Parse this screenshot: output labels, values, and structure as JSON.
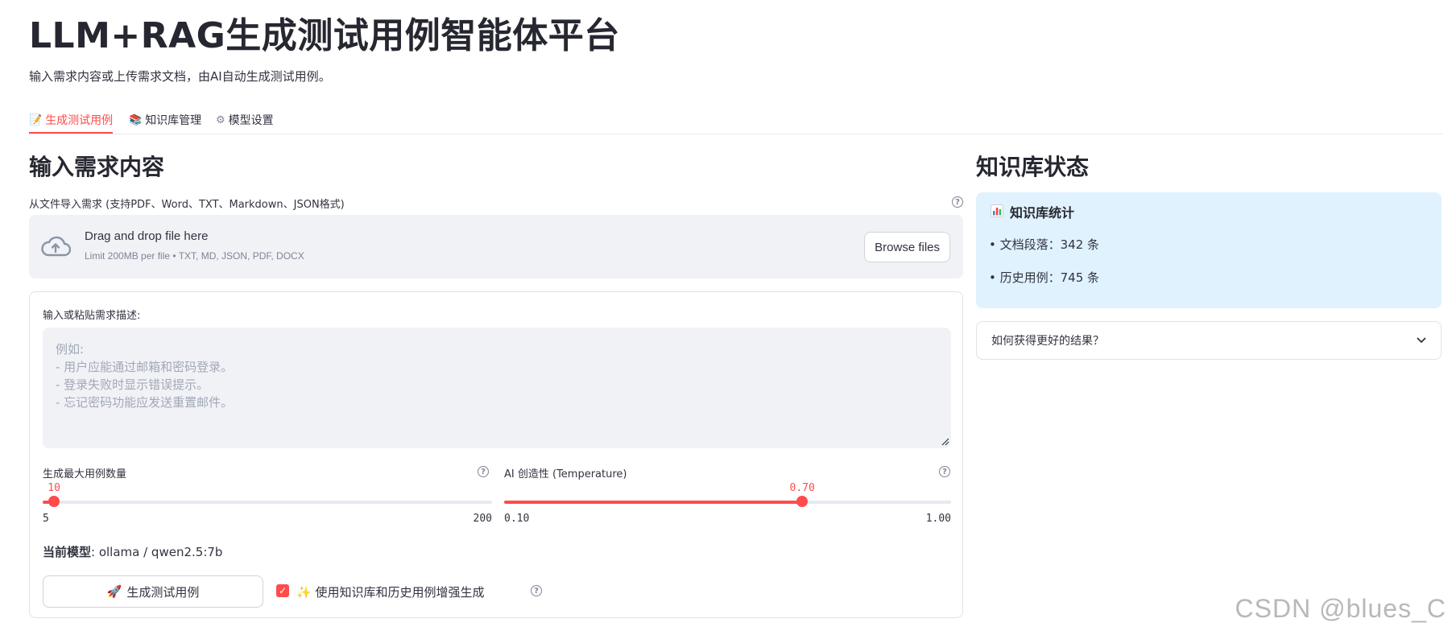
{
  "app": {
    "title": "LLM+RAG生成测试用例智能体平台",
    "subtitle": "输入需求内容或上传需求文档，由AI自动生成测试用例。"
  },
  "tabs": [
    {
      "label": "生成测试用例",
      "icon": "memo-icon",
      "active": true
    },
    {
      "label": "知识库管理",
      "icon": "books-icon",
      "active": false
    },
    {
      "label": "模型设置",
      "icon": "gear-icon",
      "active": false
    }
  ],
  "main": {
    "heading": "输入需求内容",
    "upload": {
      "label": "从文件导入需求 (支持PDF、Word、TXT、Markdown、JSON格式)",
      "drop_text": "Drag and drop file here",
      "limit_text": "Limit 200MB per file • TXT, MD, JSON, PDF, DOCX",
      "browse_label": "Browse files"
    },
    "requirement": {
      "label": "输入或粘贴需求描述:",
      "placeholder": "例如:\n- 用户应能通过邮箱和密码登录。\n- 登录失败时显示错误提示。\n- 忘记密码功能应发送重置邮件。",
      "value": ""
    },
    "max_cases": {
      "label": "生成最大用例数量",
      "value": 10,
      "value_text": "10",
      "min": 5,
      "max": 200,
      "min_text": "5",
      "max_text": "200"
    },
    "temperature": {
      "label": "AI 创造性 (Temperature)",
      "value": 0.7,
      "value_text": "0.70",
      "min": 0.1,
      "max": 1.0,
      "min_text": "0.10",
      "max_text": "1.00"
    },
    "model": {
      "label": "当前模型",
      "value": ": ollama / qwen2.5:7b"
    },
    "generate_button": "生成测试用例",
    "rag_checkbox": {
      "label": "✨ 使用知识库和历史用例增强生成",
      "checked": true
    }
  },
  "side": {
    "heading": "知识库状态",
    "stats_title": "知识库统计",
    "stats": [
      "• 文档段落：342 条",
      "• 历史用例：745 条"
    ],
    "expander_label": "如何获得更好的结果？"
  },
  "watermark": "CSDN @blues_C",
  "colors": {
    "accent": "#ff4b4b",
    "info_bg": "#e0f2fe",
    "panel_bg": "#f0f2f6"
  }
}
